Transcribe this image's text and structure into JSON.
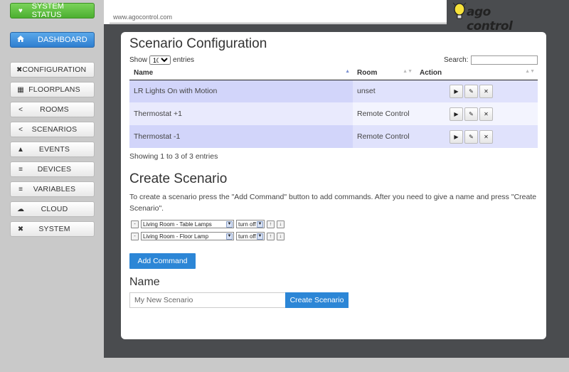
{
  "sidebar": {
    "status": {
      "label": "SYSTEM STATUS",
      "icon": "heart-icon"
    },
    "dashboard": {
      "label": "DASHBOARD",
      "icon": "home-icon"
    },
    "items": [
      {
        "label": "CONFIGURATION",
        "icon": "tools-icon"
      },
      {
        "label": "FLOORPLANS",
        "icon": "grid-icon"
      },
      {
        "label": "ROOMS",
        "icon": "share-icon"
      },
      {
        "label": "SCENARIOS",
        "icon": "share-icon"
      },
      {
        "label": "EVENTS",
        "icon": "bullhorn-icon"
      },
      {
        "label": "DEVICES",
        "icon": "list-icon"
      },
      {
        "label": "VARIABLES",
        "icon": "list-icon"
      },
      {
        "label": "CLOUD",
        "icon": "cloud-icon"
      },
      {
        "label": "SYSTEM",
        "icon": "tools-icon"
      }
    ]
  },
  "header": {
    "url": "www.agocontrol.com",
    "logo": "ago control"
  },
  "config": {
    "title": "Scenario Configuration",
    "show_label": "Show",
    "show_value": "10",
    "entries_label": "entries",
    "search_label": "Search:",
    "search_value": "",
    "columns": [
      "Name",
      "Room",
      "Action"
    ],
    "rows": [
      {
        "name": "LR Lights On with Motion",
        "room": "unset"
      },
      {
        "name": "Thermostat +1",
        "room": "Remote Control"
      },
      {
        "name": "Thermostat -1",
        "room": "Remote Control"
      }
    ],
    "info": "Showing 1 to 3 of 3 entries"
  },
  "create": {
    "title": "Create Scenario",
    "description": "To create a scenario press the \"Add Command\" button to add commands. After you need to give a name and press \"Create Scenario\".",
    "commands": [
      {
        "device": "Living Room - Table Lamps",
        "action": "turn off"
      },
      {
        "device": "Living Room - Floor Lamp",
        "action": "turn off"
      }
    ],
    "add_command": "Add Command",
    "name_title": "Name",
    "name_placeholder": "My New Scenario",
    "create_button": "Create Scenario"
  },
  "colors": {
    "status_green": "#5cbf3a",
    "primary_blue": "#2c86d6",
    "header_dark": "#4a4c4f"
  }
}
